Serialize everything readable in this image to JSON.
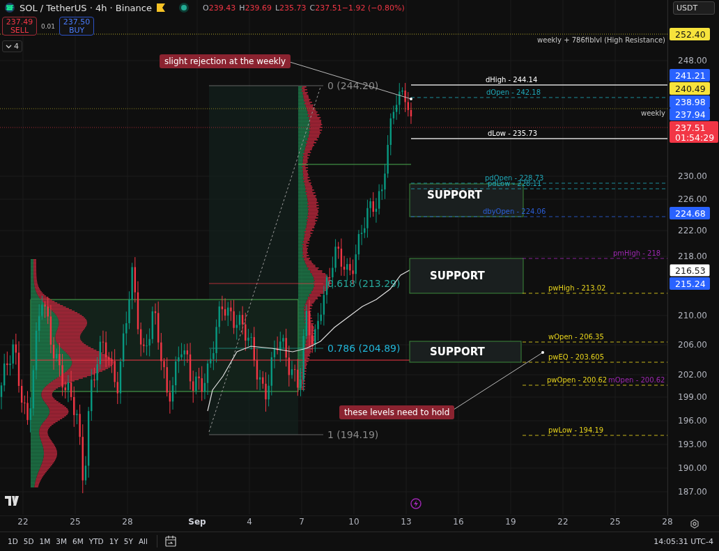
{
  "header": {
    "symbol": "SOL / TetherUS · 4h · Binance",
    "ohlc": [
      {
        "key": "O",
        "value": "239.43"
      },
      {
        "key": "H",
        "value": "239.69"
      },
      {
        "key": "L",
        "value": "235.73"
      },
      {
        "key": "C",
        "value": "237.51"
      }
    ],
    "change": "−1.92 (−0.80%)"
  },
  "trade": {
    "sell": {
      "price": "237.49",
      "label": "SELL"
    },
    "spread": "0.01",
    "buy": {
      "price": "237.50",
      "label": "BUY"
    }
  },
  "indicators": {
    "count": "4"
  },
  "currency": "USDT",
  "chart": {
    "notes": [
      "slight rejection at the weekly",
      "these levels need to hold"
    ],
    "fib_levels": [
      {
        "label": "0 (244.20)",
        "color": "#8a8a8a"
      },
      {
        "label": "0.618 (213.29)",
        "color": "#26a69a"
      },
      {
        "label": "0.786 (204.89)",
        "color": "#22b5d8"
      },
      {
        "label": "1 (194.19)",
        "color": "#8a8a8a"
      }
    ],
    "support_zones": [
      "SUPPORT",
      "SUPPORT",
      "SUPPORT"
    ],
    "line_labels": [
      "weekly + 786fiblvl (High Resistance)",
      "weekly"
    ],
    "levels": [
      {
        "label": "dHigh - 244.14",
        "color": "#ffffff"
      },
      {
        "label": "dOpen - 242.18",
        "color": "#1fa5b5"
      },
      {
        "label": "dLow - 235.73",
        "color": "#ffffff"
      },
      {
        "label": "pdOpen - 228.73",
        "color": "#1fa5b5"
      },
      {
        "label": "pdLow - 228.11",
        "color": "#1fa5b5"
      },
      {
        "label": "dbyOpen - 224.06",
        "color": "#2b5fd9"
      },
      {
        "label": "pmHigh - 218",
        "color": "#9c27b0"
      },
      {
        "label": "pwHigh - 213.02",
        "color": "#e8d41c"
      },
      {
        "label": "wOpen - 206.35",
        "color": "#e8d41c"
      },
      {
        "label": "pwEQ - 203.605",
        "color": "#e8d41c"
      },
      {
        "label": "pwOpen - 200.62",
        "color": "#e8d41c"
      },
      {
        "label": "mOpen - 200.62",
        "color": "#9c27b0"
      },
      {
        "label": "pwLow - 194.19",
        "color": "#e8d41c"
      }
    ]
  },
  "price_axis": {
    "ticks": [
      "248.00",
      "230.00",
      "226.00",
      "222.00",
      "218.00",
      "210.00",
      "206.00",
      "202.00",
      "199.00",
      "196.00",
      "193.00",
      "190.00",
      "187.00"
    ],
    "tags": [
      {
        "value": "252.40",
        "color": "#f7e33c"
      },
      {
        "value": "241.21",
        "color": "#2962ff"
      },
      {
        "value": "240.49",
        "color": "#f7e33c"
      },
      {
        "value": "238.98",
        "color": "#2962ff"
      },
      {
        "value": "237.94",
        "color": "#2962ff"
      },
      {
        "value": "237.51",
        "sub": "01:54:29",
        "color": "#f23645"
      },
      {
        "value": "224.68",
        "color": "#2962ff"
      },
      {
        "value": "216.53",
        "color": "#ffffff"
      },
      {
        "value": "215.24",
        "color": "#2962ff"
      }
    ]
  },
  "time_axis": {
    "ticks": [
      {
        "label": "22",
        "month": false
      },
      {
        "label": "25",
        "month": false
      },
      {
        "label": "28",
        "month": false
      },
      {
        "label": "Sep",
        "month": true
      },
      {
        "label": "4",
        "month": false
      },
      {
        "label": "7",
        "month": false
      },
      {
        "label": "10",
        "month": false
      },
      {
        "label": "13",
        "month": false
      },
      {
        "label": "16",
        "month": false
      },
      {
        "label": "19",
        "month": false
      },
      {
        "label": "22",
        "month": false
      },
      {
        "label": "25",
        "month": false
      },
      {
        "label": "28",
        "month": false
      }
    ]
  },
  "toolbar": {
    "ranges": [
      "1D",
      "5D",
      "1M",
      "3M",
      "6M",
      "YTD",
      "1Y",
      "5Y",
      "All"
    ],
    "clock": "14:05:31 UTC-4"
  }
}
